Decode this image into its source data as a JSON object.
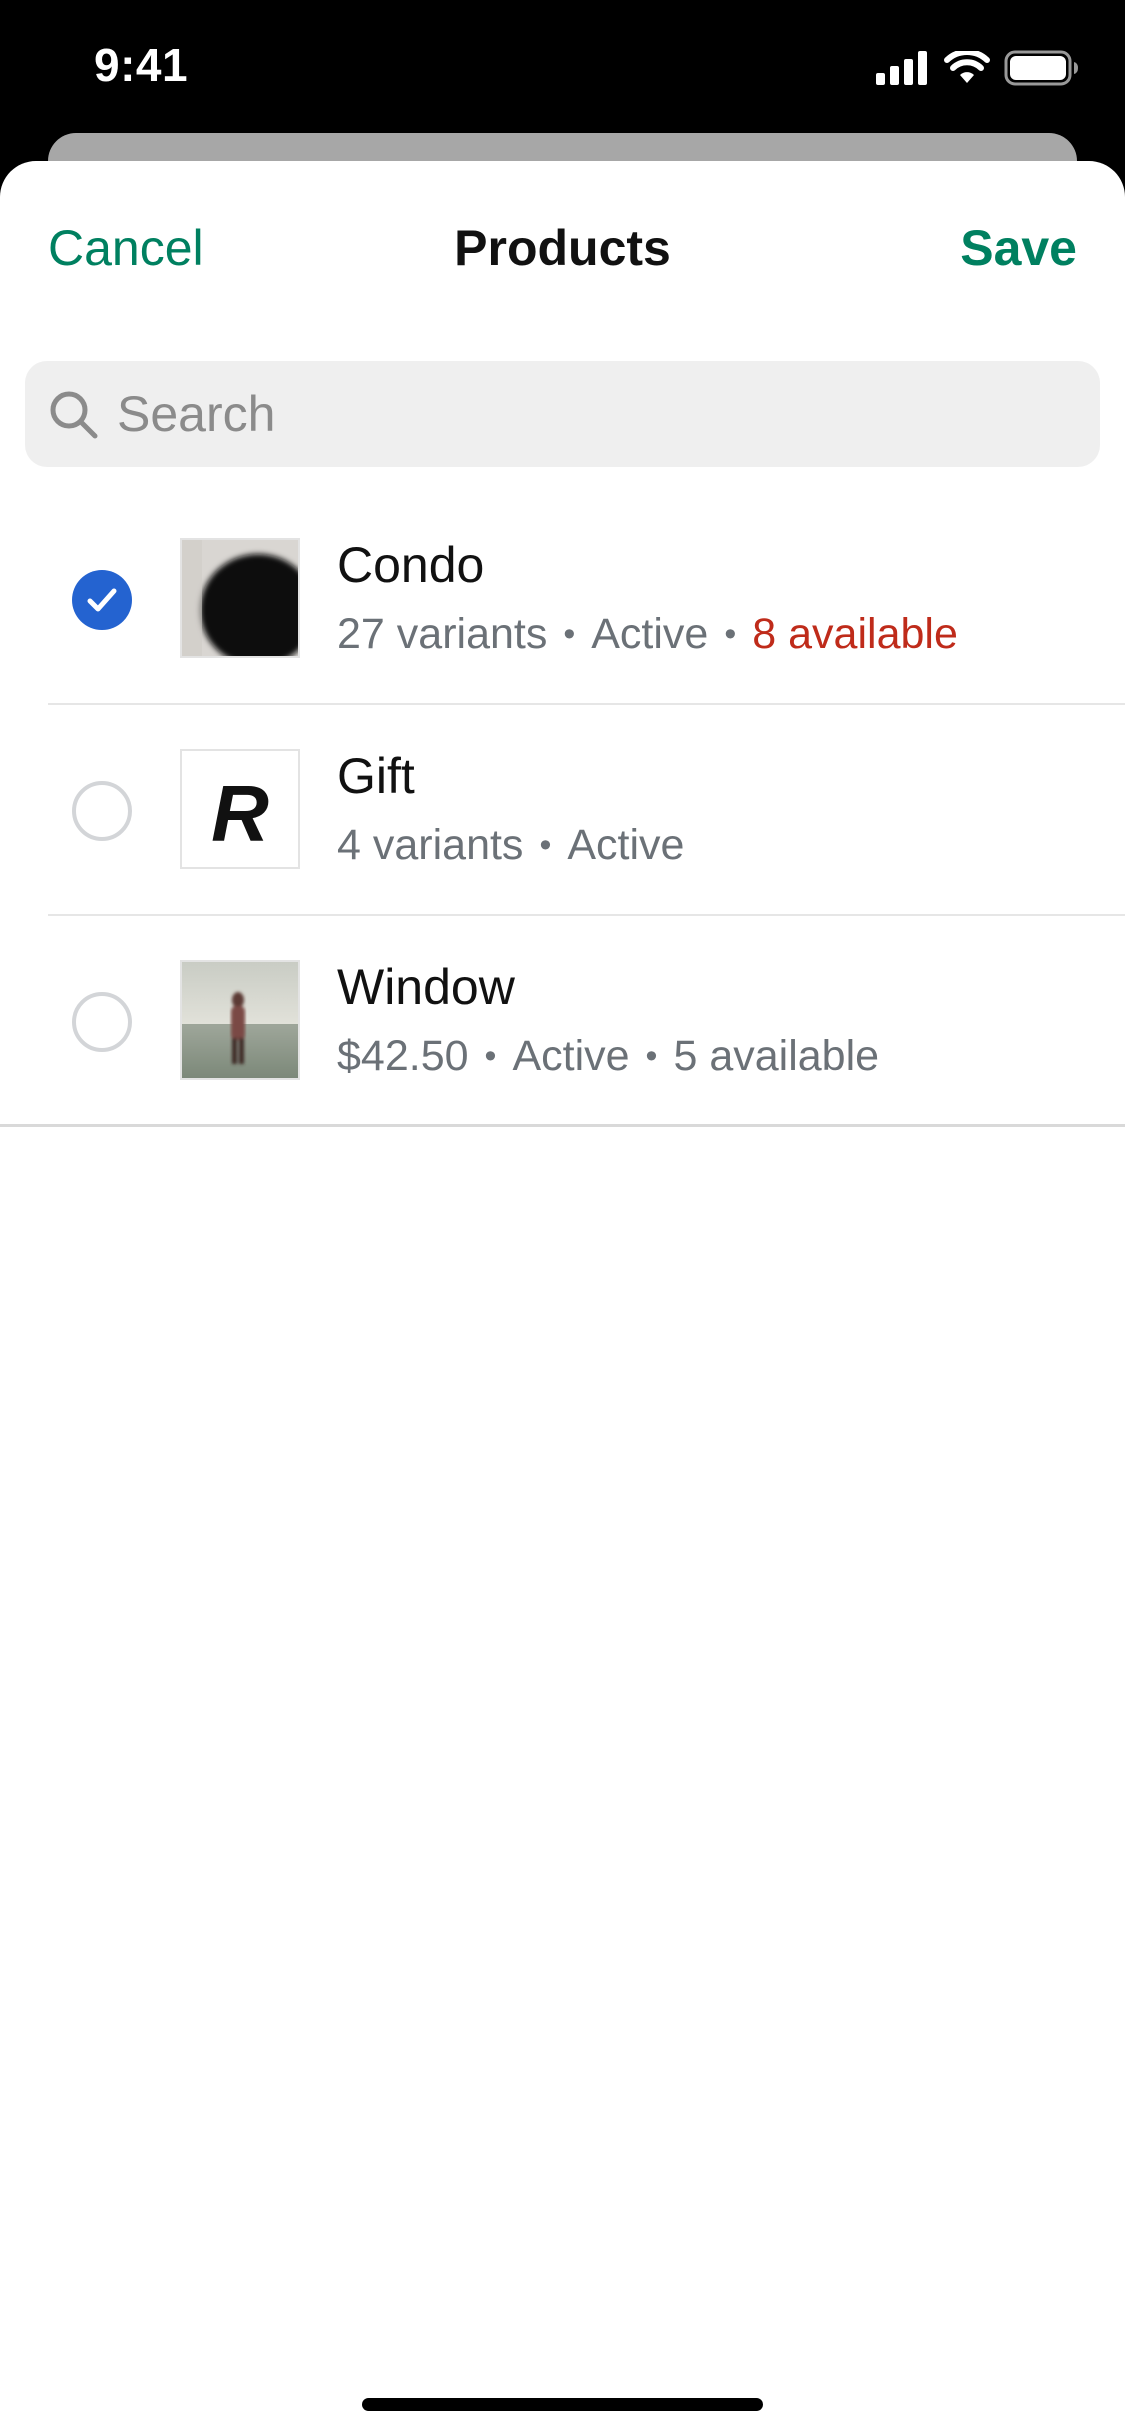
{
  "status_bar": {
    "time": "9:41",
    "icons": [
      "cellular-signal-icon",
      "wifi-icon",
      "battery-icon"
    ]
  },
  "nav": {
    "cancel_label": "Cancel",
    "title": "Products",
    "save_label": "Save"
  },
  "search": {
    "placeholder": "Search",
    "value": ""
  },
  "products": [
    {
      "name": "Condo",
      "meta": [
        "27 variants",
        "Active"
      ],
      "availability": "8 available",
      "availability_warning": true,
      "selected": true,
      "thumbnail": "dark-blob-image"
    },
    {
      "name": "Gift",
      "meta": [
        "4 variants",
        "Active"
      ],
      "availability": "",
      "availability_warning": false,
      "selected": false,
      "thumbnail": "letter-r-logo",
      "thumbnail_text": "R"
    },
    {
      "name": "Window",
      "meta": [
        "$42.50",
        "Active"
      ],
      "availability": "5 available",
      "availability_warning": false,
      "selected": false,
      "thumbnail": "person-on-shore-photo"
    }
  ],
  "colors": {
    "accent": "#008060",
    "checkbox_selected": "#2463d0",
    "warning": "#bf2b1a",
    "meta_text": "#6b7177"
  }
}
